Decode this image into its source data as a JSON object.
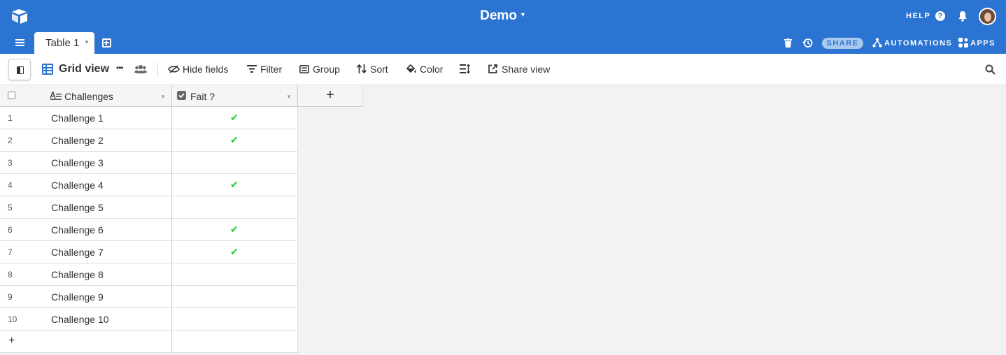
{
  "header": {
    "base_title": "Demo",
    "help_label": "HELP",
    "help_glyph": "?",
    "share_label": "SHARE",
    "automations_label": "AUTOMATIONS",
    "apps_label": "APPS",
    "accent_color": "#2b74d1"
  },
  "tabs": [
    {
      "label": "Table 1",
      "active": true
    }
  ],
  "viewbar": {
    "view_name": "Grid view",
    "more_glyph": "•••",
    "hide_fields": "Hide fields",
    "filter": "Filter",
    "group": "Group",
    "sort": "Sort",
    "color": "Color",
    "share_view": "Share view"
  },
  "table": {
    "columns": [
      {
        "name": "Challenges",
        "type": "text",
        "icon": "long-text-icon"
      },
      {
        "name": "Fait ?",
        "type": "checkbox",
        "icon": "checkbox-icon"
      }
    ],
    "add_column_glyph": "+",
    "add_row_glyph": "+",
    "check_glyph": "✔",
    "check_color": "#20c933",
    "rows": [
      {
        "num": "1",
        "challenge": "Challenge 1",
        "done": true
      },
      {
        "num": "2",
        "challenge": "Challenge 2",
        "done": true
      },
      {
        "num": "3",
        "challenge": "Challenge 3",
        "done": false
      },
      {
        "num": "4",
        "challenge": "Challenge 4",
        "done": true
      },
      {
        "num": "5",
        "challenge": "Challenge 5",
        "done": false
      },
      {
        "num": "6",
        "challenge": "Challenge 6",
        "done": true
      },
      {
        "num": "7",
        "challenge": "Challenge 7",
        "done": true
      },
      {
        "num": "8",
        "challenge": "Challenge 8",
        "done": false
      },
      {
        "num": "9",
        "challenge": "Challenge 9",
        "done": false
      },
      {
        "num": "10",
        "challenge": "Challenge 10",
        "done": false
      }
    ]
  }
}
